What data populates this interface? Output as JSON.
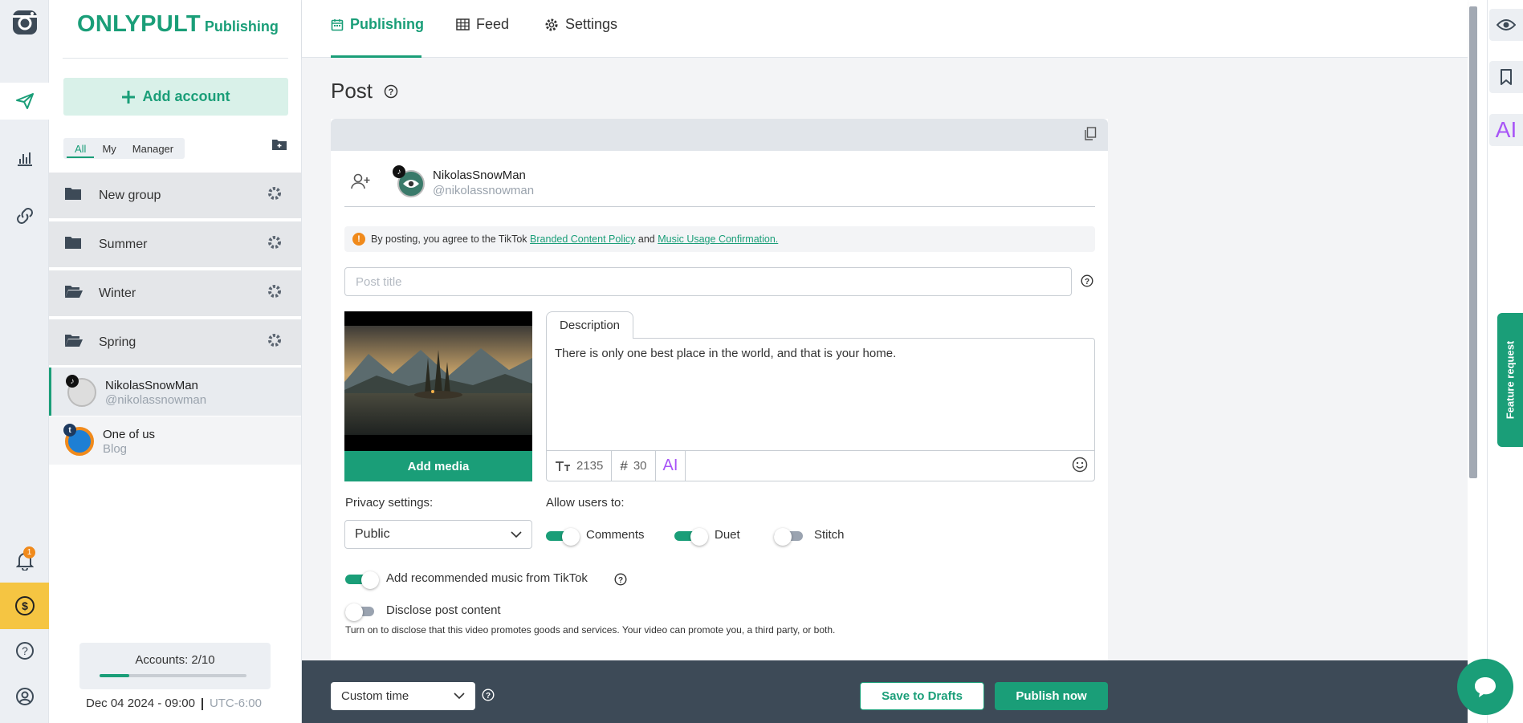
{
  "logo": {
    "brand": "ONLYPULT",
    "sub": "Publishing"
  },
  "sidebar": {
    "add_account": "Add account",
    "filters": [
      "All",
      "My",
      "Manager"
    ],
    "groups": [
      {
        "label": "New group"
      },
      {
        "label": "Summer"
      },
      {
        "label": "Winter"
      },
      {
        "label": "Spring"
      }
    ],
    "accounts": [
      {
        "name": "NikolasSnowMan",
        "handle": "@nikolassnowman",
        "network": "tiktok"
      },
      {
        "name": "One of us",
        "handle": "Blog",
        "network": "tumblr"
      }
    ],
    "accounts_count": "Accounts: 2/10",
    "accounts_progress": 0.2,
    "date": "Dec 04 2024 - 09:00",
    "timezone": "UTC-6:00"
  },
  "rail": {
    "notification_count": "1"
  },
  "nav": {
    "tabs": [
      "Publishing",
      "Feed",
      "Settings"
    ],
    "active": "Publishing"
  },
  "post": {
    "heading": "Post",
    "account": {
      "name": "NikolasSnowMan",
      "handle": "@nikolassnowman"
    },
    "notice": {
      "text_1": "By posting, you agree to the TikTok",
      "link_1": "Branded Content Policy",
      "text_2": "and",
      "link_2": "Music Usage Confirmation."
    },
    "title_placeholder": "Post title",
    "add_media": "Add media",
    "description_tab": "Description",
    "description": "There is only one best place in the world, and that is your home.",
    "char_count": "2135",
    "hashtag_count": "30",
    "ai_label": "AI",
    "privacy_label": "Privacy settings:",
    "privacy_value": "Public",
    "allow_label": "Allow users to:",
    "allow": [
      {
        "label": "Comments",
        "on": true
      },
      {
        "label": "Duet",
        "on": true
      },
      {
        "label": "Stitch",
        "on": false
      }
    ],
    "music_label": "Add recommended music from TikTok",
    "music_on": true,
    "disclose_label": "Disclose post content",
    "disclose_on": false,
    "disclose_note": "Turn on to disclose that this video promotes goods and services. Your video can promote you, a third party, or both."
  },
  "bottom": {
    "time_mode": "Custom time",
    "save_drafts": "Save to Drafts",
    "publish_now": "Publish now"
  },
  "right": {
    "ai_label": "AI",
    "feature_request": "Feature request"
  },
  "colors": {
    "accent": "#1a9e78",
    "notice_warn": "#f08a1c",
    "ai_purple": "#a855f7",
    "bottom_bar": "#3d4a57"
  }
}
